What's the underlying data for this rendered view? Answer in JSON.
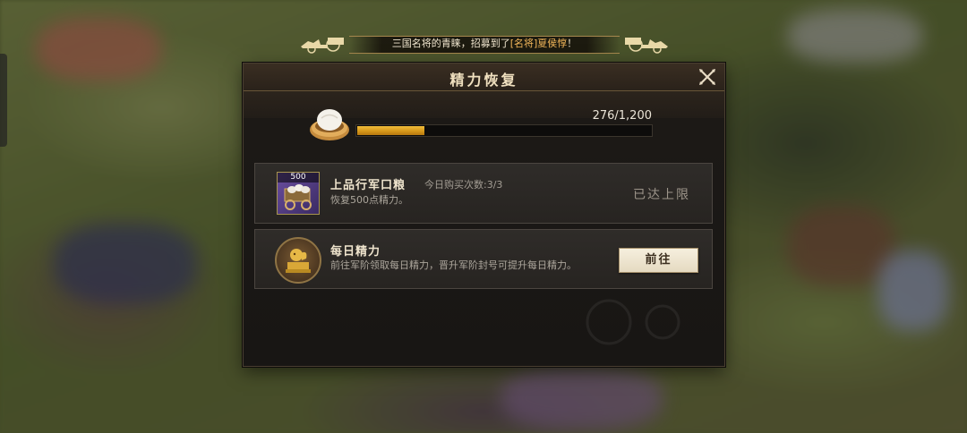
{
  "marquee": {
    "prefix": "三国名将的青睐，招募到了",
    "highlight": "[名将]夏侯惇",
    "suffix": "！"
  },
  "dialog": {
    "title": "精力恢复",
    "close_icon": "close-x-icon"
  },
  "energy": {
    "current": 276,
    "max": 1200,
    "text": "276/1,200",
    "fraction": 0.23,
    "icon": "steamed-bun-icon"
  },
  "items": [
    {
      "name": "上品行军口粮",
      "purchase_count": "今日购买次数:3/3",
      "description": "恢复500点精力。",
      "badge": "500",
      "status": "已达上限",
      "icon": "ration-cart-icon"
    },
    {
      "name": "每日精力",
      "description": "前往军阶领取每日精力，晋升军阶封号可提升每日精力。",
      "button": "前往",
      "icon": "golden-lion-icon"
    }
  ],
  "colors": {
    "accent": "#d39418",
    "highlight": "#f2b65a",
    "panel": "#1d1a17"
  }
}
